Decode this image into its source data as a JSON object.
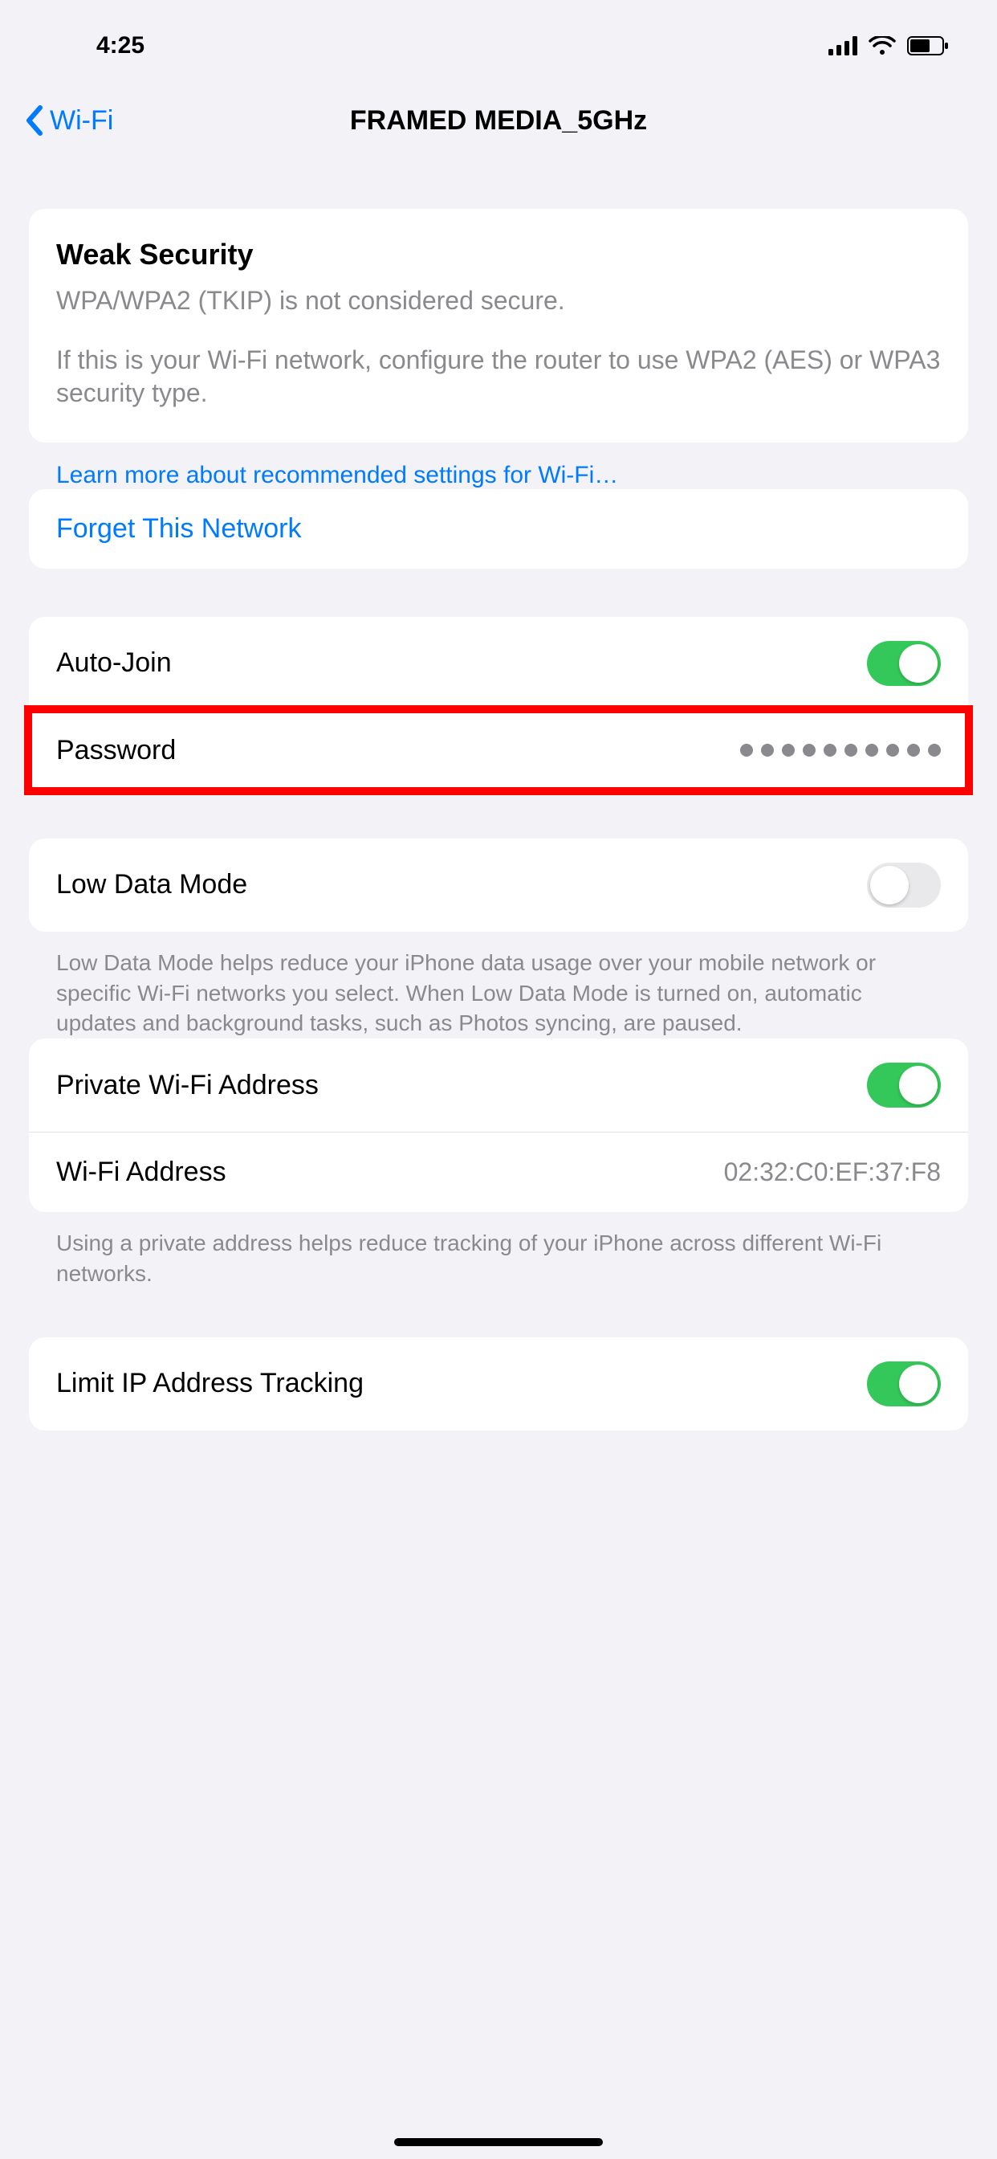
{
  "status": {
    "time": "4:25"
  },
  "nav": {
    "back_label": "Wi-Fi",
    "title": "FRAMED MEDIA_5GHz"
  },
  "security": {
    "title": "Weak Security",
    "line1": "WPA/WPA2 (TKIP) is not considered secure.",
    "line2": "If this is your Wi-Fi network, configure the router to use WPA2 (AES) or WPA3 security type."
  },
  "learn_more": "Learn more about recommended settings for Wi-Fi…",
  "forget": "Forget This Network",
  "auto_join": {
    "label": "Auto-Join",
    "on": true
  },
  "password": {
    "label": "Password",
    "dots": 10
  },
  "low_data": {
    "label": "Low Data Mode",
    "on": false,
    "footer": "Low Data Mode helps reduce your iPhone data usage over your mobile network or specific Wi-Fi networks you select. When Low Data Mode is turned on, automatic updates and background tasks, such as Photos syncing, are paused."
  },
  "private_addr": {
    "label": "Private Wi-Fi Address",
    "on": true
  },
  "wifi_addr": {
    "label": "Wi-Fi Address",
    "value": "02:32:C0:EF:37:F8"
  },
  "private_footer": "Using a private address helps reduce tracking of your iPhone across different Wi-Fi networks.",
  "limit_ip": {
    "label": "Limit IP Address Tracking",
    "on": true
  },
  "colors": {
    "accent": "#007aff",
    "switch_on": "#34c759",
    "highlight": "#ff0000"
  }
}
